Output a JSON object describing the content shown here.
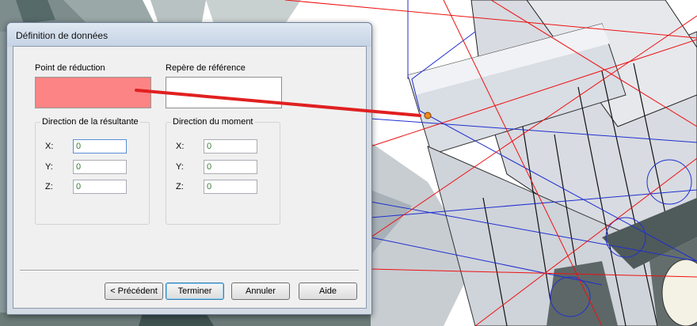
{
  "window": {
    "title": "Définition de données"
  },
  "reduction_point": {
    "label": "Point de réduction"
  },
  "reference_frame": {
    "label": "Repère de référence"
  },
  "resultant_direction": {
    "legend": "Direction de la résultante",
    "x": {
      "label": "X:",
      "value": "0"
    },
    "y": {
      "label": "Y:",
      "value": "0"
    },
    "z": {
      "label": "Z:",
      "value": "0"
    }
  },
  "moment_direction": {
    "legend": "Direction du moment",
    "x": {
      "label": "X:",
      "value": "0"
    },
    "y": {
      "label": "Y:",
      "value": "0"
    },
    "z": {
      "label": "Z:",
      "value": "0"
    }
  },
  "buttons": {
    "previous": "< Précédent",
    "finish": "Terminer",
    "cancel": "Annuler",
    "help": "Aide"
  },
  "colors": {
    "reduction_point_fill": "#fc8484",
    "connector_line": "#e02020",
    "selected_point": "#f08a1c"
  }
}
